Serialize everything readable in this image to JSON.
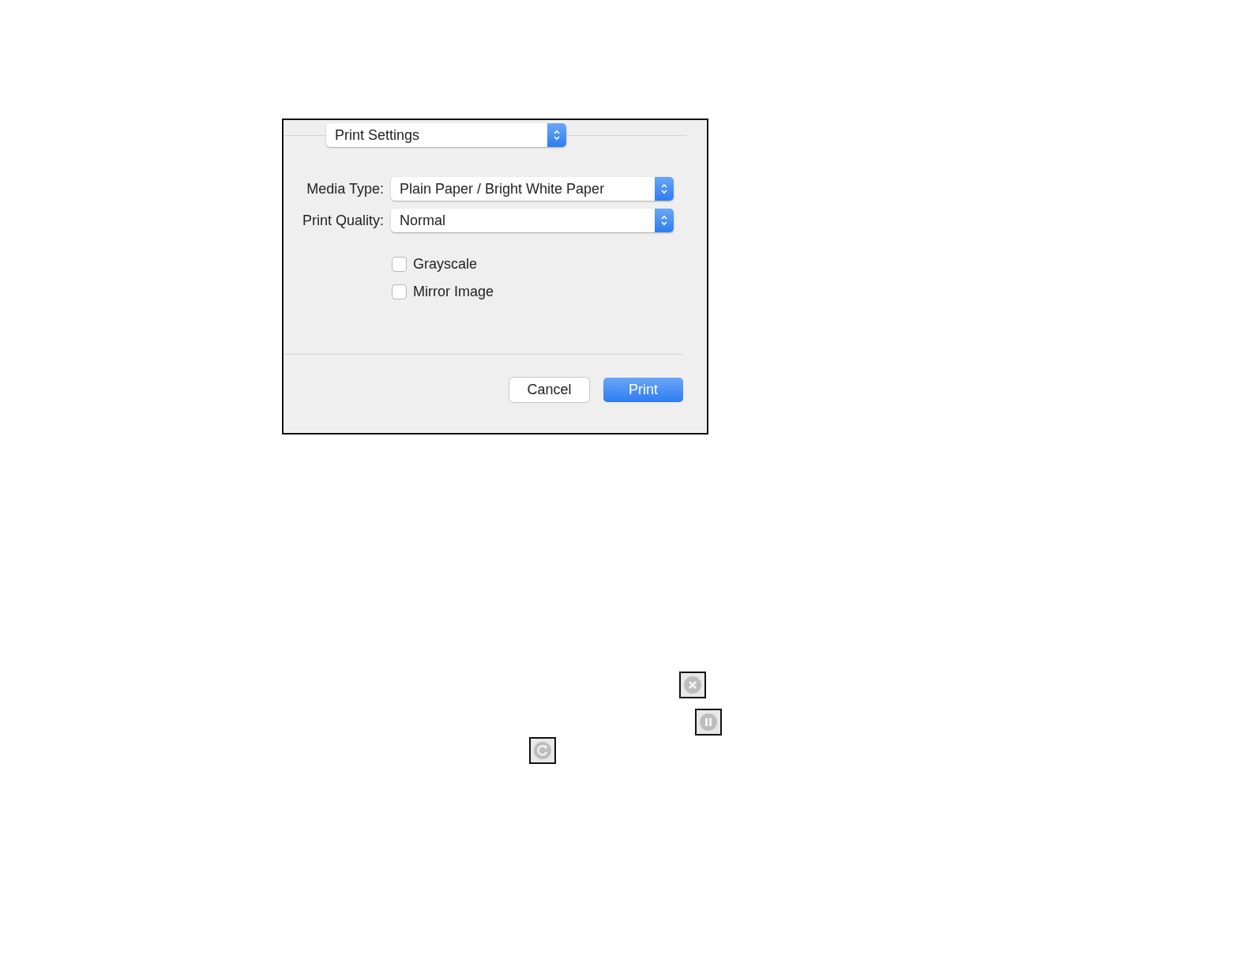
{
  "panel_menu": {
    "value": "Print Settings"
  },
  "fields": [
    {
      "label": "Media Type:",
      "value": "Plain Paper / Bright White Paper"
    },
    {
      "label": "Print Quality:",
      "value": "Normal"
    }
  ],
  "checkboxes": [
    {
      "label": "Grayscale",
      "checked": false
    },
    {
      "label": "Mirror Image",
      "checked": false
    }
  ],
  "buttons": [
    {
      "label": "Cancel",
      "kind": "secondary"
    },
    {
      "label": "Print",
      "kind": "primary"
    }
  ]
}
